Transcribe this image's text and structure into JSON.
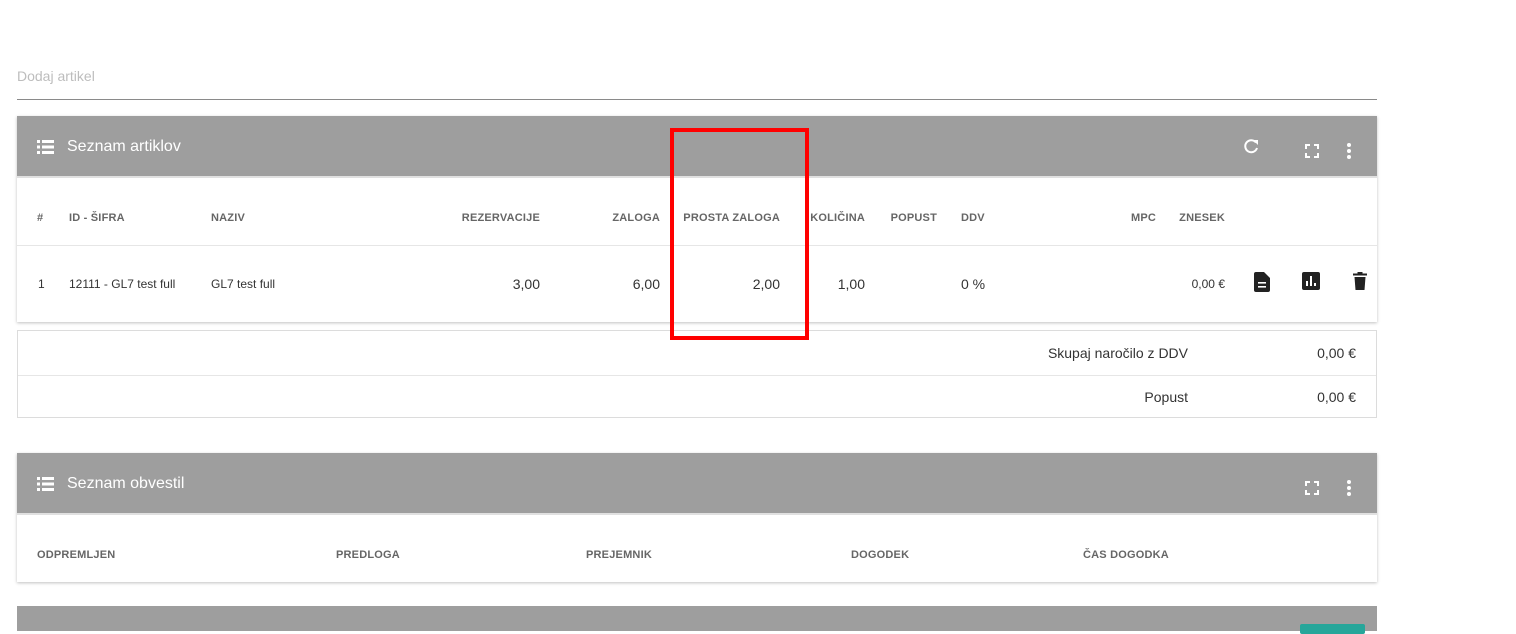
{
  "add_article": {
    "placeholder": "Dodaj artikel",
    "value": ""
  },
  "articles_panel": {
    "title": "Seznam artiklov",
    "columns": [
      "#",
      "ID - ŠIFRA",
      "NAZIV",
      "REZERVACIJE",
      "ZALOGA",
      "PROSTA ZALOGA",
      "KOLIČINA",
      "POPUST",
      "DDV",
      "MPC",
      "ZNESEK"
    ],
    "rows": [
      {
        "num": "1",
        "id": "12111 - GL7 test full",
        "name": "GL7 test full",
        "reservations": "3,00",
        "stock": "6,00",
        "free_stock": "2,00",
        "quantity": "1,00",
        "discount": "",
        "vat": "0 %",
        "price": "",
        "amount": "0,00 €"
      }
    ],
    "icons": [
      "refresh-icon",
      "fullscreen-icon",
      "more-vert-icon",
      "document-icon",
      "chart-icon",
      "trash-icon"
    ]
  },
  "totals": {
    "order_total_label": "Skupaj naročilo z DDV",
    "order_total_value": "0,00 €",
    "discount_label": "Popust",
    "discount_value": "0,00 €"
  },
  "notifications_panel": {
    "title": "Seznam obvestil",
    "columns": [
      "ODPREMLJEN",
      "PREDLOGA",
      "PREJEMNIK",
      "DOGODEK",
      "ČAS DOGODKA"
    ]
  },
  "colors": {
    "panel_header": "#9e9e9e",
    "highlight": "#ff0000",
    "accent": "#26a69a"
  }
}
